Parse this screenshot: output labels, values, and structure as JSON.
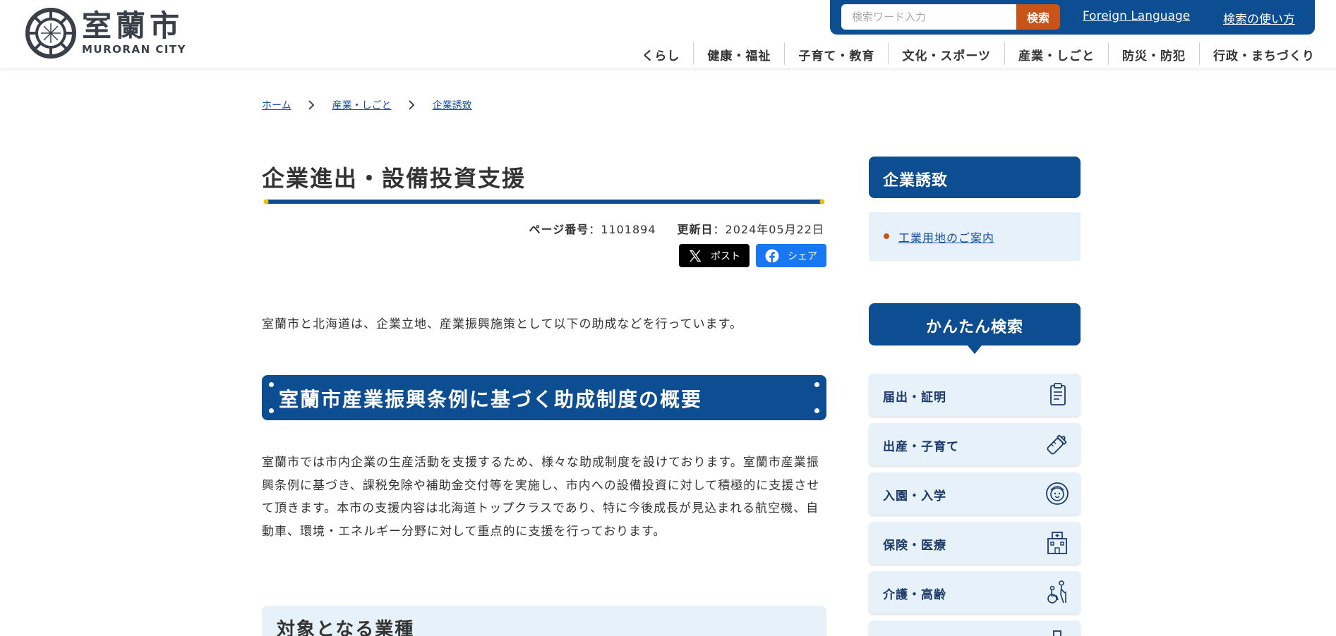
{
  "header": {
    "logo_jp": "室蘭市",
    "logo_en": "MURORAN CITY",
    "search_placeholder": "検索ワード入力",
    "search_button": "検索",
    "link_foreign": "Foreign Language",
    "link_howto": "検索の使い方",
    "nav": [
      "くらし",
      "健康・福祉",
      "子育て・教育",
      "文化・スポーツ",
      "産業・しごと",
      "防災・防犯",
      "行政・まちづくり"
    ]
  },
  "breadcrumb": [
    "ホーム",
    "産業・しごと",
    "企業誘致"
  ],
  "main": {
    "title": "企業進出・設備投資支援",
    "page_number_label": "ページ番号",
    "page_number": "1101894",
    "updated_label": "更新日",
    "updated": "2024年05月22日",
    "share_x": "ポスト",
    "share_fb": "シェア",
    "intro": "室蘭市と北海道は、企業立地、産業振興施策として以下の助成などを行っています。",
    "section_heading": "室蘭市産業振興条例に基づく助成制度の概要",
    "paragraph": "室蘭市では市内企業の生産活動を支援するため、様々な助成制度を設けております。室蘭市産業振興条例に基づき、課税免除や補助金交付等を実施し、市内への設備投資に対して積極的に支援させて頂きます。本市の支援内容は北海道トップクラスであり、特に今後成長が見込まれる航空機、自動車、環境・エネルギー分野に対して重点的に支援を行っております。",
    "subsection_heading": "対象となる業種"
  },
  "sidebar": {
    "heading": "企業誘致",
    "links": [
      "工業用地のご案内"
    ],
    "easy_search": "かんたん検索",
    "categories": [
      {
        "label": "届出・証明",
        "icon": "document-icon"
      },
      {
        "label": "出産・子育て",
        "icon": "baby-bottle-icon"
      },
      {
        "label": "入園・入学",
        "icon": "child-face-icon"
      },
      {
        "label": "保険・医療",
        "icon": "hospital-icon"
      },
      {
        "label": "介護・高齢",
        "icon": "elderly-care-icon"
      }
    ]
  },
  "colors": {
    "primary": "#0d4d91",
    "accent": "#c8541a",
    "light_panel": "#e6f1f9",
    "link": "#1a4fa0",
    "title_rule_dot": "#e6c200"
  }
}
